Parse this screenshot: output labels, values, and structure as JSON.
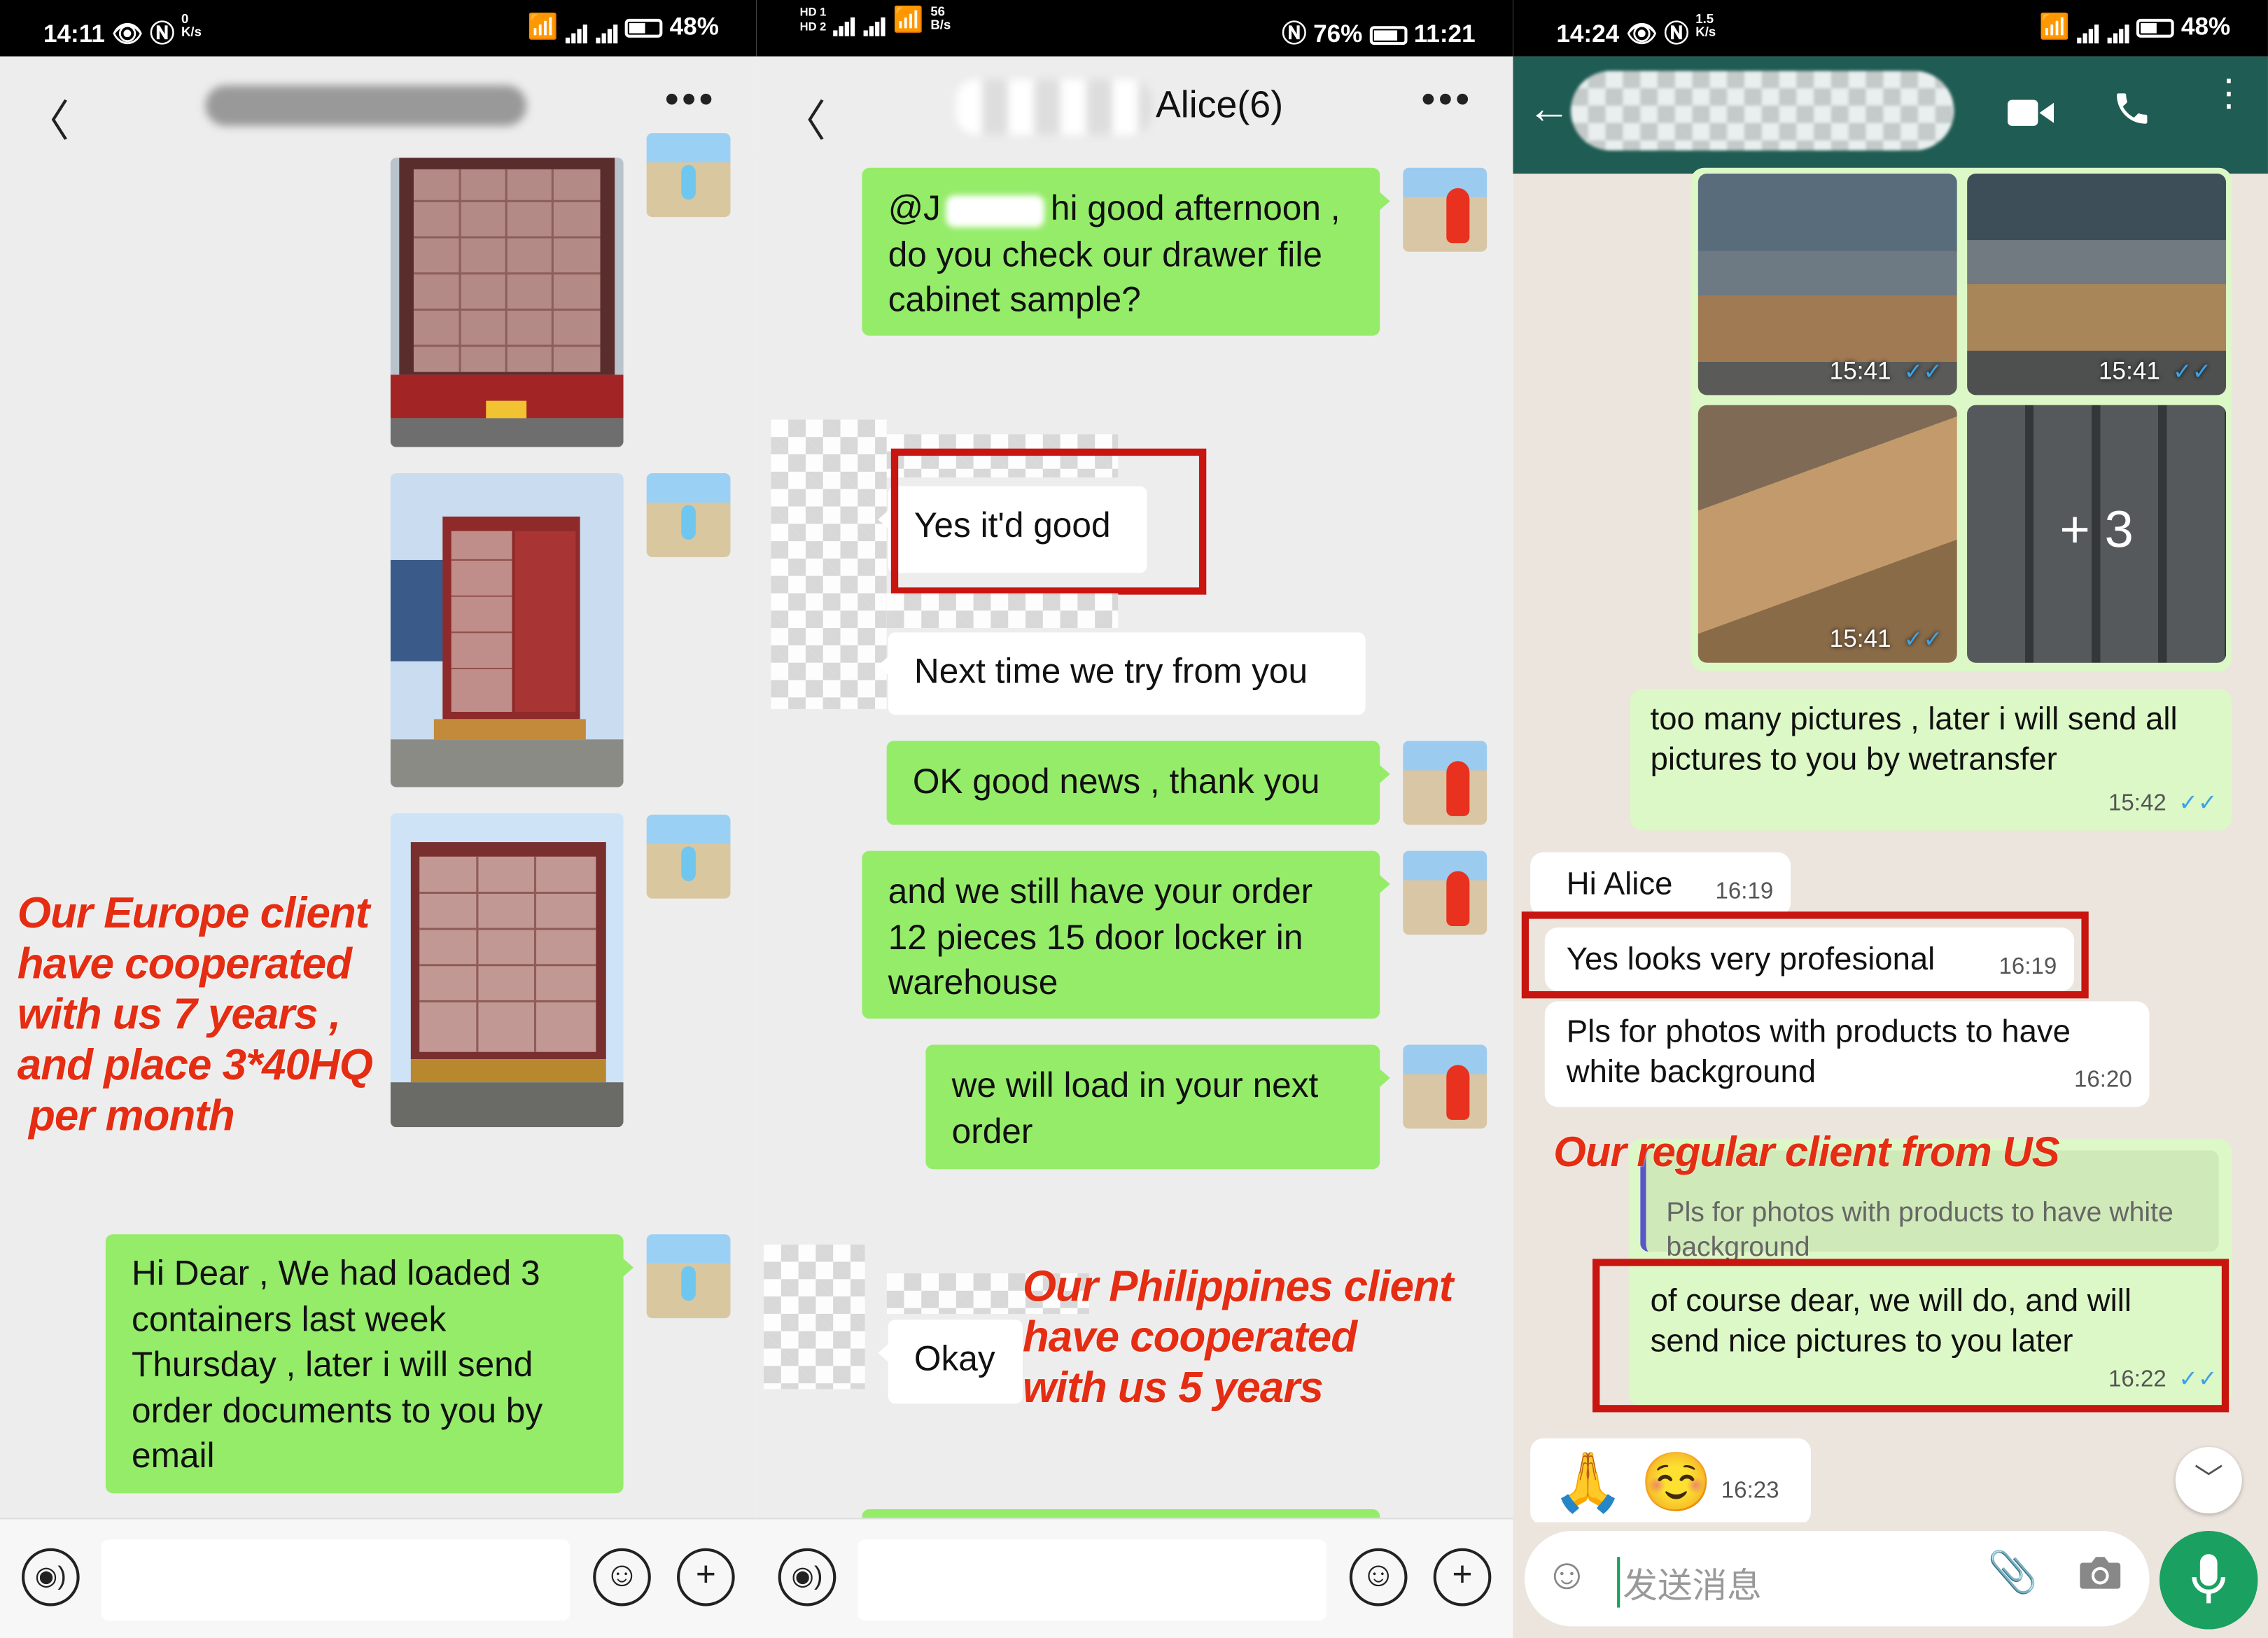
{
  "panel1": {
    "status": {
      "time": "14:11",
      "speed": "0",
      "speed_unit": "K/s",
      "battery": "48%",
      "battery_level": 0.48
    },
    "annotation": [
      "Our Europe client",
      "have cooperated",
      "with us 7 years ,",
      "and place 3*40HQ",
      " per month"
    ],
    "message": "Hi Dear , We had loaded 3 containers last week Thursday , later i will send order documents to you by email"
  },
  "panel2": {
    "status": {
      "hd1": "HD 1",
      "hd2": "HD 2",
      "speed": "56",
      "speed_unit": "B/s",
      "battery": "76%",
      "battery_level": 0.76,
      "time": "11:21"
    },
    "title": "Alice(6)",
    "messages": {
      "m1_prefix": "@J",
      "m1_rest": "hi good afternoon ,",
      "m1_line2": "do you check our drawer file cabinet sample?",
      "m2": "Yes it'd good",
      "m3": "Next time we try from you",
      "m4": "OK good news , thank you",
      "m5": "and we still have your order 12 pieces 15 door locker in warehouse",
      "m6": "we will load in your next order",
      "m7": "Okay"
    },
    "annotation": [
      "Our Philippines client",
      "have cooperated",
      "with us 5 years"
    ]
  },
  "panel3": {
    "status": {
      "time": "14:24",
      "speed": "1.5",
      "speed_unit": "K/s",
      "battery": "48%",
      "battery_level": 0.48
    },
    "photos": {
      "t1": "15:41",
      "t2": "15:41",
      "t3": "15:41",
      "more": "+ 3"
    },
    "messages": {
      "m1": "too many pictures , later i will send all pictures to you by wetransfer",
      "m1_time": "15:42",
      "m2": "Hi Alice",
      "m2_time": "16:19",
      "m3": "Yes looks very profesional",
      "m3_time": "16:19",
      "m4": "Pls for photos with products to have white background",
      "m4_time": "16:20",
      "quote": "Pls for photos with products to have white background",
      "m5": "of course dear, we will do, and will send nice pictures to you later",
      "m5_time": "16:22",
      "m6_emoji": "🙏 ☺️",
      "m6_time": "16:23"
    },
    "annotation": "Our regular client from US",
    "input_placeholder": "发送消息"
  },
  "colors": {
    "wechat_green": "#95ec69",
    "whatsapp_header": "#1f5c54",
    "whatsapp_out": "#dcf8c6",
    "annotation_red": "#e42d12",
    "highlight_box": "#c8150f",
    "mic_button": "#1aa060"
  }
}
